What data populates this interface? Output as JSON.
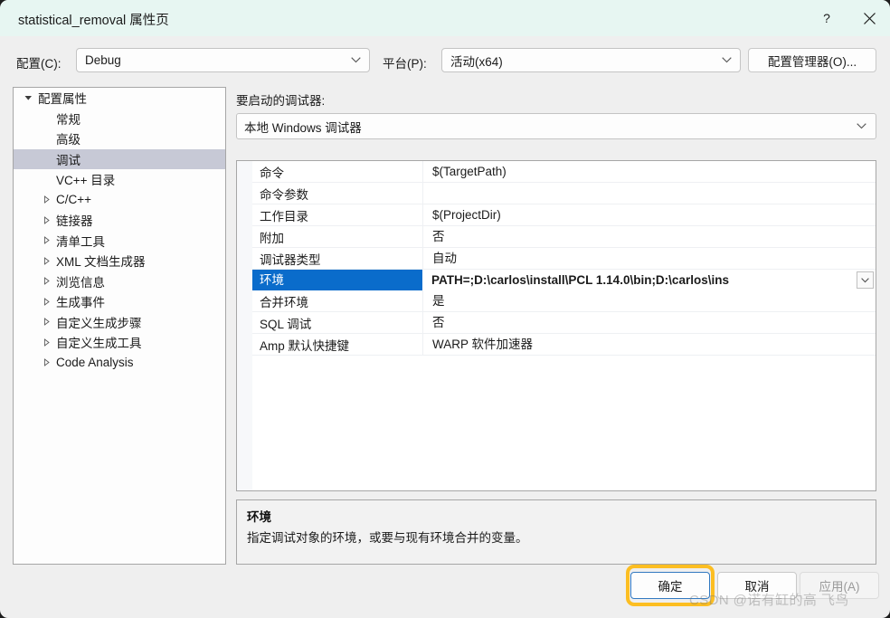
{
  "window": {
    "title": "statistical_removal 属性页",
    "help_label": "?",
    "close_label": "×"
  },
  "top_bar": {
    "config_label": "配置(C):",
    "config_value": "Debug",
    "platform_label": "平台(P):",
    "platform_value": "活动(x64)",
    "config_manager_label": "配置管理器(O)..."
  },
  "tree": {
    "items": [
      {
        "label": "配置属性",
        "depth": 0,
        "arrow": "expanded",
        "selected": false
      },
      {
        "label": "常规",
        "depth": 1,
        "arrow": "none",
        "selected": false
      },
      {
        "label": "高级",
        "depth": 1,
        "arrow": "none",
        "selected": false
      },
      {
        "label": "调试",
        "depth": 1,
        "arrow": "none",
        "selected": true
      },
      {
        "label": "VC++ 目录",
        "depth": 1,
        "arrow": "none",
        "selected": false
      },
      {
        "label": "C/C++",
        "depth": 1,
        "arrow": "collapsed",
        "selected": false
      },
      {
        "label": "链接器",
        "depth": 1,
        "arrow": "collapsed",
        "selected": false
      },
      {
        "label": "清单工具",
        "depth": 1,
        "arrow": "collapsed",
        "selected": false
      },
      {
        "label": "XML 文档生成器",
        "depth": 1,
        "arrow": "collapsed",
        "selected": false
      },
      {
        "label": "浏览信息",
        "depth": 1,
        "arrow": "collapsed",
        "selected": false
      },
      {
        "label": "生成事件",
        "depth": 1,
        "arrow": "collapsed",
        "selected": false
      },
      {
        "label": "自定义生成步骤",
        "depth": 1,
        "arrow": "collapsed",
        "selected": false
      },
      {
        "label": "自定义生成工具",
        "depth": 1,
        "arrow": "collapsed",
        "selected": false
      },
      {
        "label": "Code Analysis",
        "depth": 1,
        "arrow": "collapsed",
        "selected": false
      }
    ]
  },
  "right_pane": {
    "debugger_label": "要启动的调试器:",
    "debugger_value": "本地 Windows 调试器",
    "grid": [
      {
        "name": "命令",
        "value": "$(TargetPath)",
        "selected": false
      },
      {
        "name": "命令参数",
        "value": "",
        "selected": false
      },
      {
        "name": "工作目录",
        "value": "$(ProjectDir)",
        "selected": false
      },
      {
        "name": "附加",
        "value": "否",
        "selected": false
      },
      {
        "name": "调试器类型",
        "value": "自动",
        "selected": false
      },
      {
        "name": "环境",
        "value": "PATH=;D:\\carlos\\install\\PCL 1.14.0\\bin;D:\\carlos\\ins",
        "selected": true
      },
      {
        "name": "合并环境",
        "value": "是",
        "selected": false
      },
      {
        "name": "SQL 调试",
        "value": "否",
        "selected": false
      },
      {
        "name": "Amp 默认快捷键",
        "value": "WARP 软件加速器",
        "selected": false
      }
    ],
    "description": {
      "title": "环境",
      "body": "指定调试对象的环境，或要与现有环境合并的变量。"
    }
  },
  "footer": {
    "ok_label": "确定",
    "cancel_label": "取消",
    "apply_label": "应用(A)",
    "ok_highlight_color": "#fcbe22"
  },
  "watermark": "CSDN @诺有缸的高 飞鸟",
  "colors": {
    "titlebar": "#e7f6f2",
    "dialog_bg": "#efefef",
    "tree_selection": "#c7c9d6",
    "grid_selection": "#0a6ccb",
    "accent_border": "#3279c0"
  }
}
